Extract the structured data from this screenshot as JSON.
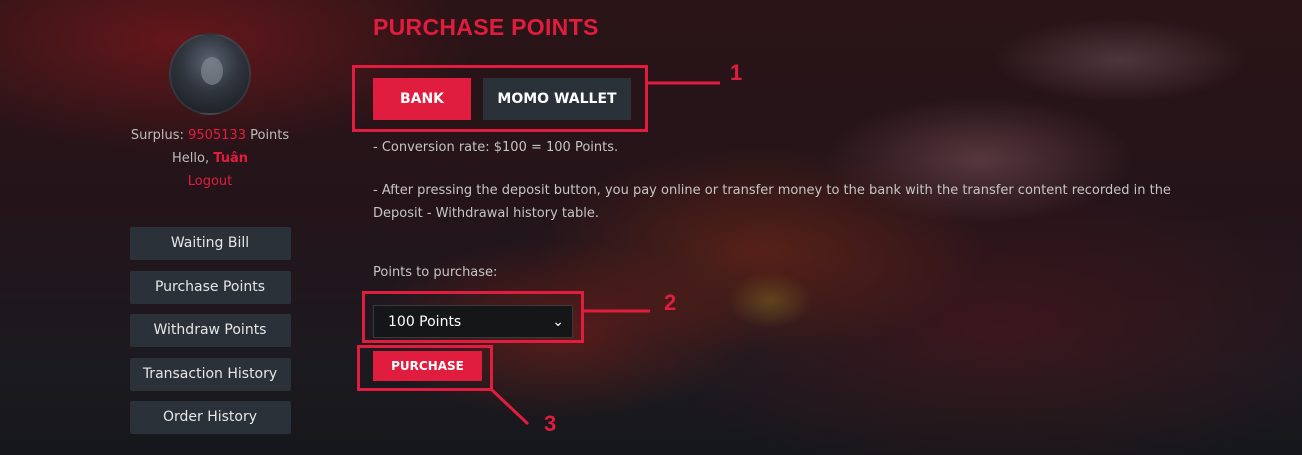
{
  "sidebar": {
    "surplus_label": "Surplus:",
    "surplus_value": "9505133",
    "surplus_unit": "Points",
    "hello_label": "Hello,",
    "username": "Tuân",
    "logout_label": "Logout",
    "menu": [
      {
        "label": "Waiting Bill"
      },
      {
        "label": "Purchase Points"
      },
      {
        "label": "Withdraw Points"
      },
      {
        "label": "Transaction History"
      },
      {
        "label": "Order History"
      }
    ]
  },
  "main": {
    "title": "PURCHASE POINTS",
    "tabs": [
      {
        "label": "BANK"
      },
      {
        "label": "MOMO WALLET"
      }
    ],
    "conversion_text": "- Conversion rate: $100 = 100 Points.",
    "instruction_text": "- After pressing the deposit button, you pay online or transfer money to the bank with the transfer content recorded in the Deposit - Withdrawal history table.",
    "points_label": "Points to purchase:",
    "select_value": "100 Points",
    "purchase_label": "PURCHASE"
  },
  "annotations": {
    "n1": "1",
    "n2": "2",
    "n3": "3"
  },
  "colors": {
    "accent": "#e11d3f",
    "button_dark": "#2b3138"
  }
}
